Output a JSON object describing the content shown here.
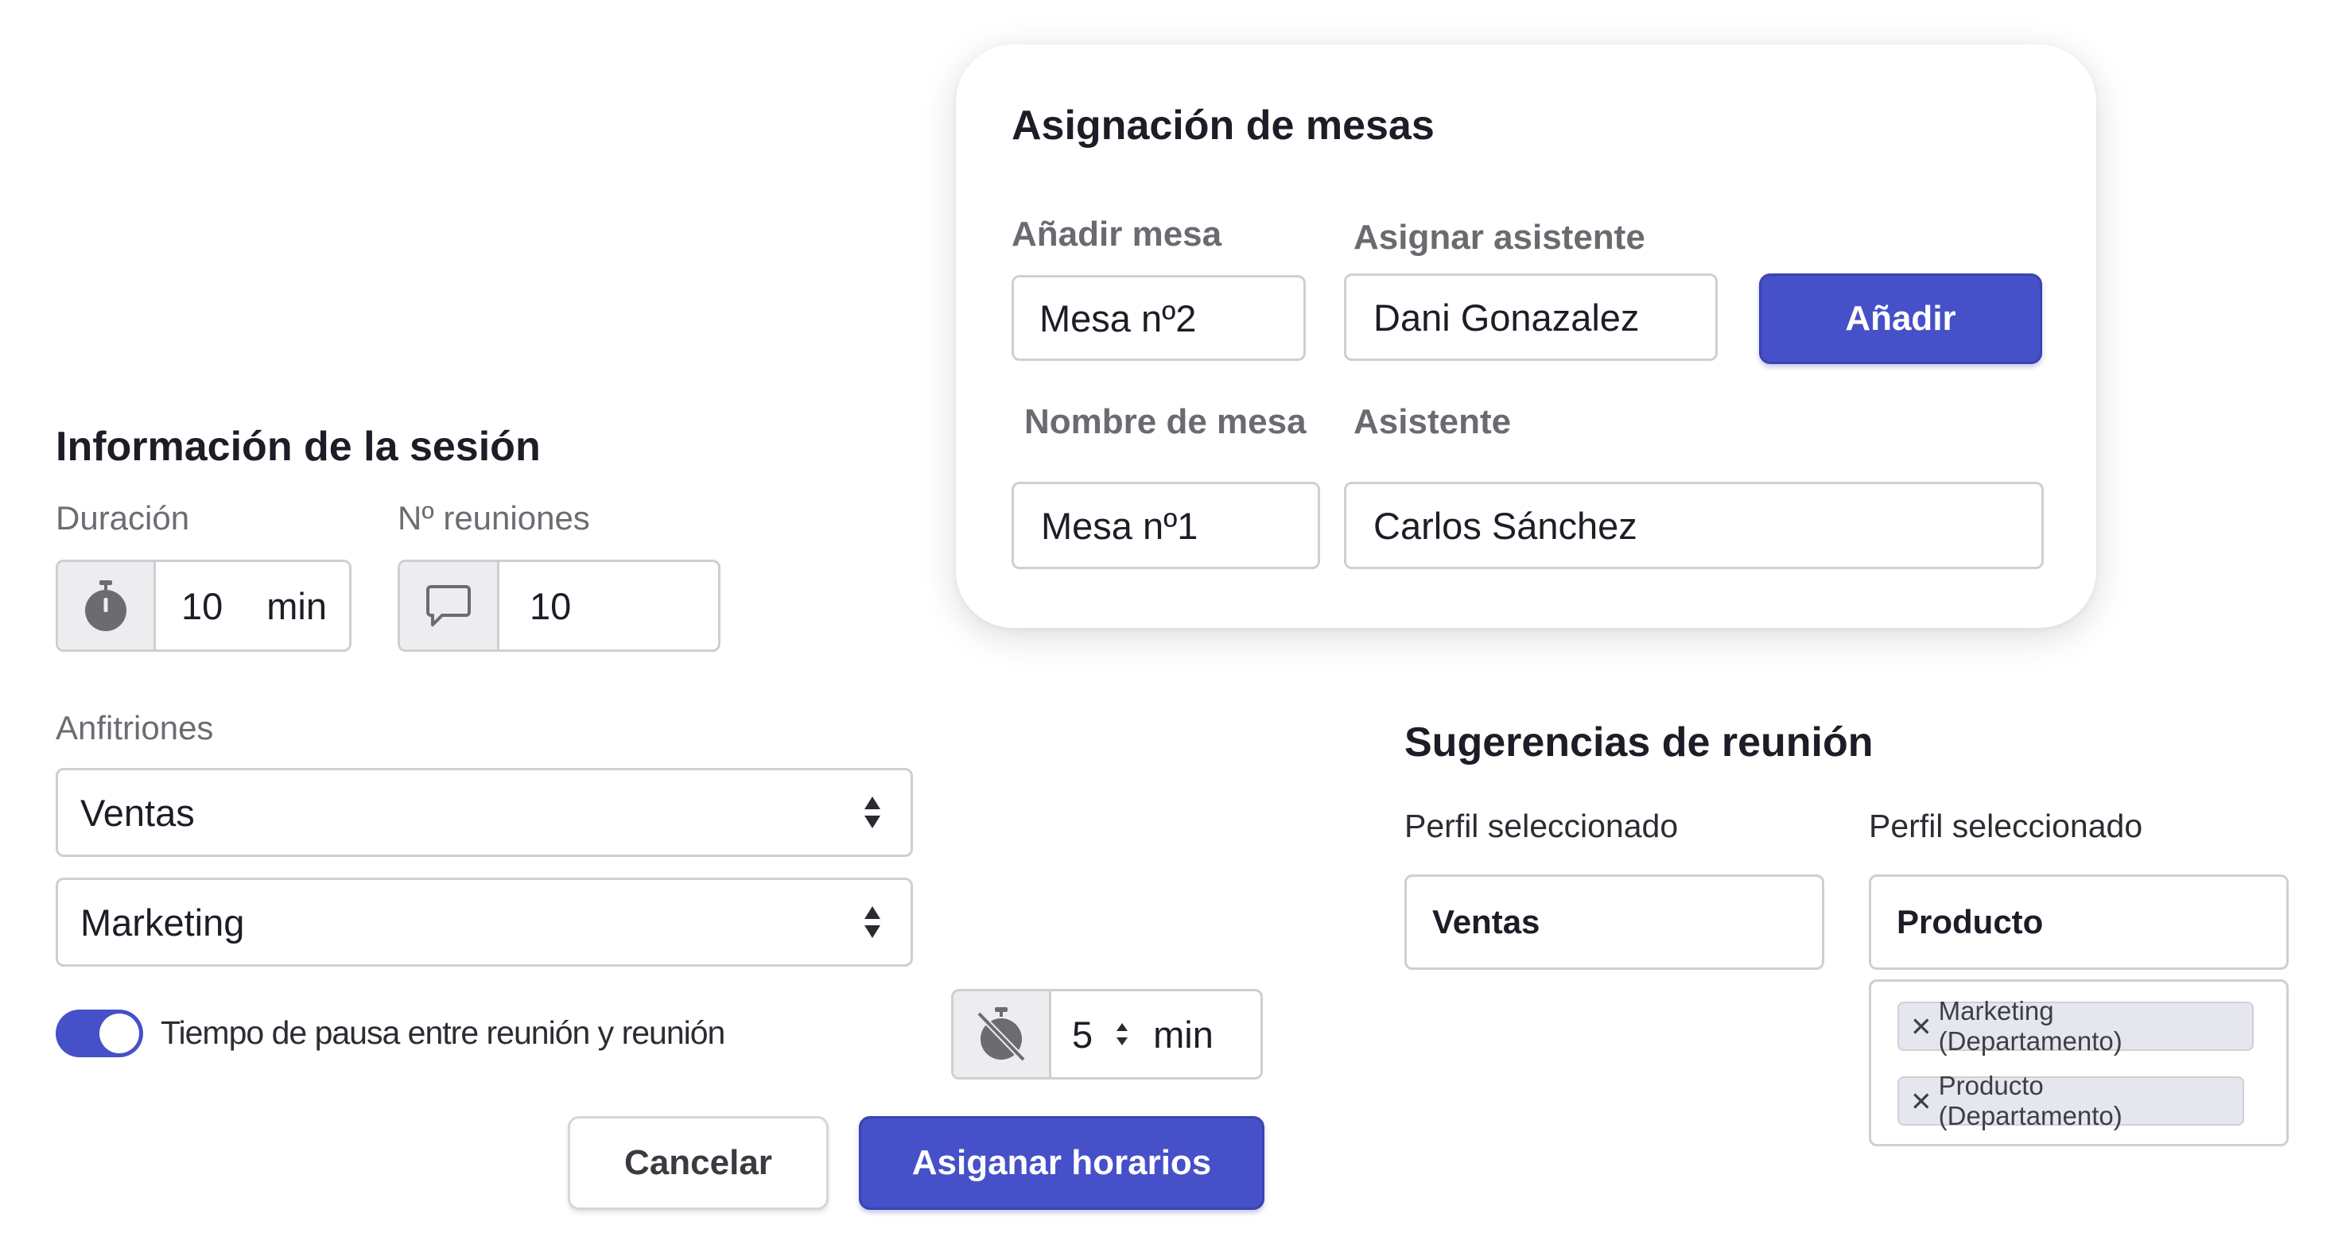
{
  "assign_tables": {
    "title": "Asignación de mesas",
    "add_table_label": "Añadir mesa",
    "add_table_value": "Mesa nº2",
    "assign_attendee_label": "Asignar asistente",
    "assign_attendee_value": "Dani Gonazalez",
    "add_button": "Añadir",
    "table_name_header": "Nombre de mesa",
    "attendee_header": "Asistente",
    "rows": [
      {
        "table": "Mesa nº1",
        "attendee": "Carlos Sánchez"
      }
    ]
  },
  "session": {
    "title": "Información de la sesión",
    "duration_label": "Duración",
    "duration_value": "10",
    "duration_unit": "min",
    "meetings_label": "Nº reuniones",
    "meetings_value": "10",
    "hosts_label": "Anfitriones",
    "hosts": [
      "Ventas",
      "Marketing"
    ],
    "pause_toggle_label": "Tiempo de pausa entre reunión y reunión",
    "pause_toggle_on": true,
    "pause_value": "5",
    "pause_unit": "min",
    "cancel_button": "Cancelar",
    "submit_button": "Asiganar horarios"
  },
  "suggestions": {
    "title": "Sugerencias de reunión",
    "left_label": "Perfil seleccionado",
    "left_value": "Ventas",
    "right_label": "Perfil seleccionado",
    "right_value": "Producto",
    "tags": [
      "Marketing (Departamento)",
      "Producto (Departamento)"
    ]
  },
  "colors": {
    "primary": "#4650c8",
    "border": "#cfcfd3",
    "icon_bg": "#ededef"
  },
  "icons": {
    "duration": "stopwatch-icon",
    "meetings": "chat-bubble-icon",
    "select": "sort-arrows-icon",
    "pause": "stopwatch-off-icon",
    "tag_remove": "close-icon"
  }
}
